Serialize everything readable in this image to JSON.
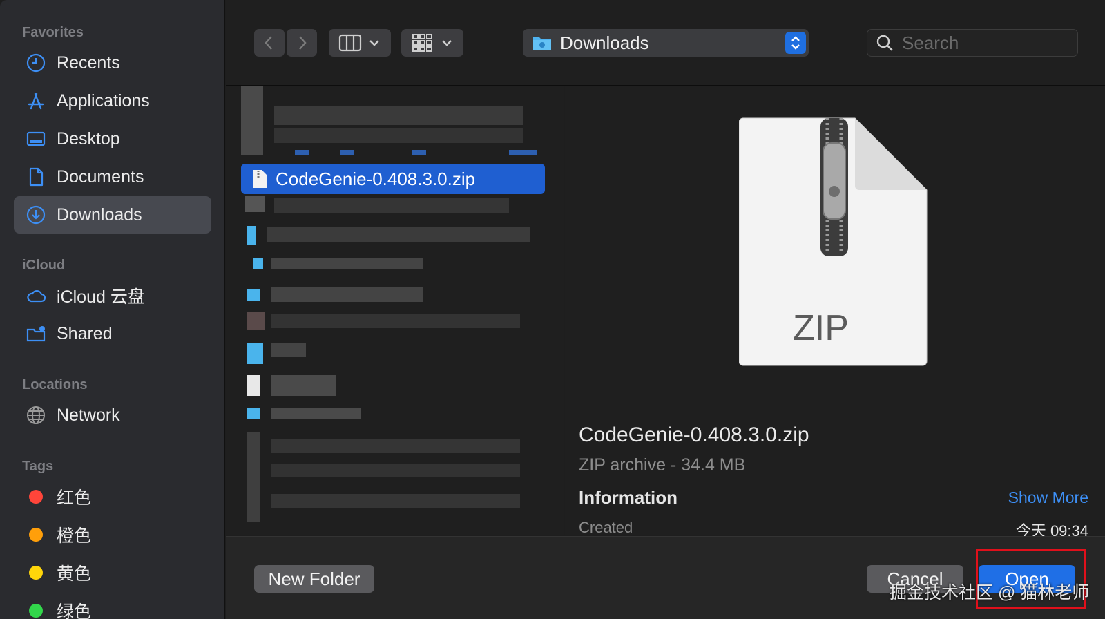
{
  "sidebar": {
    "favorites_label": "Favorites",
    "favorites": [
      {
        "label": "Recents",
        "icon": "clock-icon"
      },
      {
        "label": "Applications",
        "icon": "applications-icon"
      },
      {
        "label": "Desktop",
        "icon": "desktop-icon"
      },
      {
        "label": "Documents",
        "icon": "document-icon"
      },
      {
        "label": "Downloads",
        "icon": "download-icon",
        "selected": true
      }
    ],
    "icloud_label": "iCloud",
    "icloud": [
      {
        "label": "iCloud 云盘",
        "icon": "cloud-icon"
      },
      {
        "label": "Shared",
        "icon": "shared-folder-icon"
      }
    ],
    "locations_label": "Locations",
    "locations": [
      {
        "label": "Network",
        "icon": "globe-icon"
      }
    ],
    "tags_label": "Tags",
    "tags": [
      {
        "label": "红色",
        "color": "#ff453a"
      },
      {
        "label": "橙色",
        "color": "#ff9f0a"
      },
      {
        "label": "黄色",
        "color": "#ffd60a"
      },
      {
        "label": "绿色",
        "color": "#32d74b"
      }
    ]
  },
  "toolbar": {
    "location": "Downloads",
    "search_placeholder": "Search"
  },
  "filelist": {
    "selected_file": "CodeGenie-0.408.3.0.zip"
  },
  "preview": {
    "icon_label": "ZIP",
    "name": "CodeGenie-0.408.3.0.zip",
    "kind": "ZIP archive - 34.4 MB",
    "info_label": "Information",
    "show_more": "Show More",
    "created_label": "Created",
    "created_value": "今天 09:34"
  },
  "bottombar": {
    "new_folder": "New Folder",
    "cancel": "Cancel",
    "open": "Open"
  },
  "watermark": "掘金技术社区 @ 猫林老师",
  "colors": {
    "accent": "#1f6fe6",
    "sidebar_icon": "#3d8ff5",
    "annotation_box": "#e0101b"
  }
}
